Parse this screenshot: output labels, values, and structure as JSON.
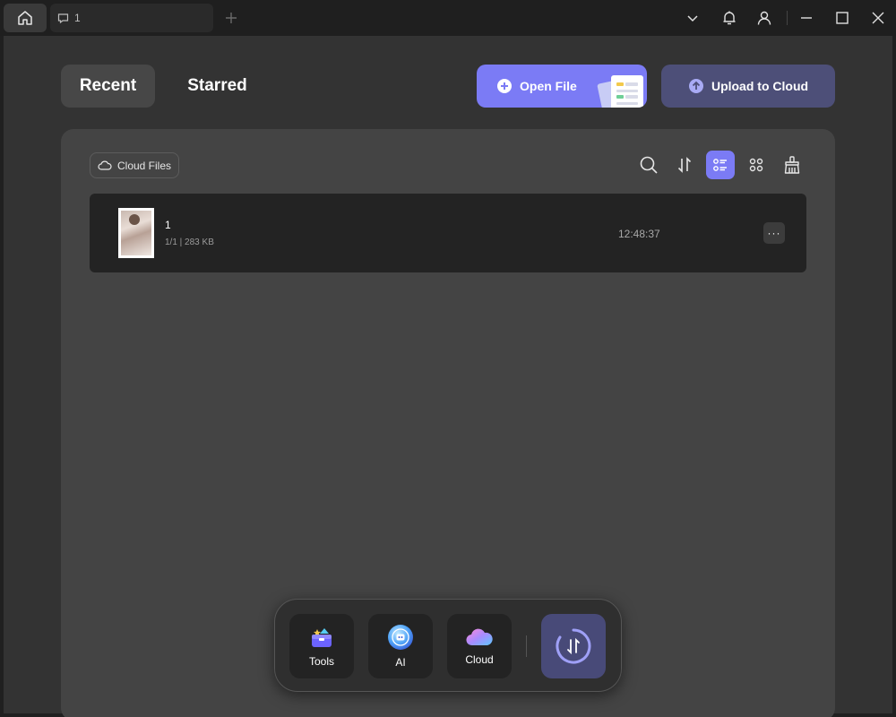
{
  "titlebar": {
    "doc_tab_label": "1"
  },
  "tabs": {
    "recent": "Recent",
    "starred": "Starred"
  },
  "actions": {
    "open_file": "Open File",
    "upload_to_cloud": "Upload to Cloud"
  },
  "panel": {
    "cloud_files": "Cloud Files"
  },
  "files": [
    {
      "name": "1",
      "meta": "1/1 | 283 KB",
      "time": "12:48:37",
      "more": "···"
    }
  ],
  "dock": {
    "tools": "Tools",
    "ai": "AI",
    "cloud": "Cloud"
  },
  "colors": {
    "accent": "#7b7bf5",
    "upload_button": "#4d4f78",
    "background": "#333333",
    "panel": "#444444"
  }
}
